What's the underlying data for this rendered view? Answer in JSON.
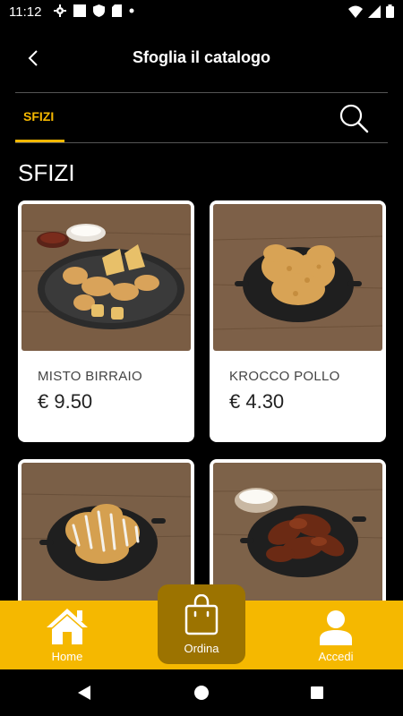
{
  "status_bar": {
    "time": "11:12"
  },
  "header": {
    "title": "Sfoglia il catalogo"
  },
  "tabs": [
    {
      "label": "SFIZI",
      "active": true
    }
  ],
  "section": {
    "title": "SFIZI"
  },
  "products": [
    {
      "name": "MISTO BIRRAIO",
      "price": "€ 9.50"
    },
    {
      "name": "KROCCO POLLO",
      "price": "€ 4.30"
    },
    {
      "name": "",
      "price": ""
    },
    {
      "name": "",
      "price": ""
    }
  ],
  "bottom_nav": {
    "home_label": "Home",
    "order_label": "Ordina",
    "login_label": "Accedi"
  },
  "colors": {
    "accent": "#f5b800",
    "order_button": "#9c7300"
  }
}
